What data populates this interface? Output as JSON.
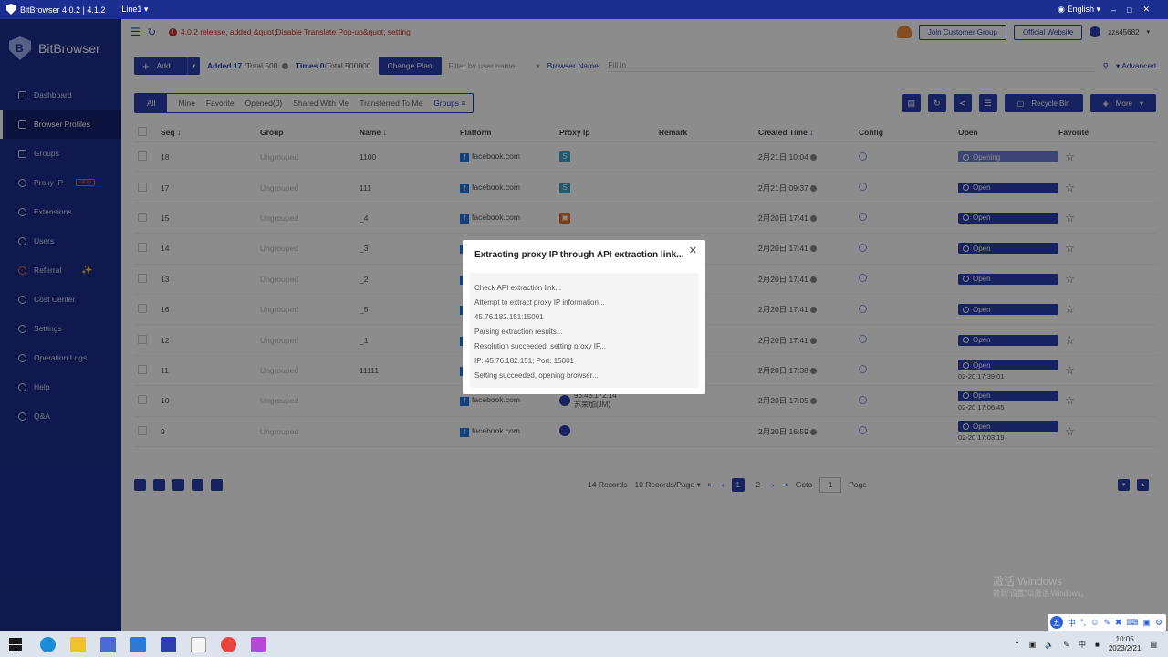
{
  "window": {
    "title": "BitBrowser 4.0.2 | 4.1.2",
    "line": "Line1",
    "language": "English"
  },
  "sidebar": {
    "brand": "BitBrowser",
    "items": [
      {
        "label": "Dashboard",
        "icon": "dashboard-icon"
      },
      {
        "label": "Browser Profiles",
        "icon": "grid-icon",
        "active": true
      },
      {
        "label": "Groups",
        "icon": "layers-icon"
      },
      {
        "label": "Proxy IP",
        "icon": "location-icon",
        "badge": "NEW"
      },
      {
        "label": "Extensions",
        "icon": "puzzle-icon"
      },
      {
        "label": "Users",
        "icon": "users-icon"
      },
      {
        "label": "Referral",
        "icon": "referral-icon",
        "badge": "✨"
      },
      {
        "label": "Cost Center",
        "icon": "shield-icon"
      },
      {
        "label": "Settings",
        "icon": "gear-icon"
      },
      {
        "label": "Operation Logs",
        "icon": "logs-icon"
      },
      {
        "label": "Help",
        "icon": "help-icon"
      },
      {
        "label": "Q&A",
        "icon": "info-icon"
      }
    ]
  },
  "topbar": {
    "notice": "4.0.2 release, added &quot;Disable Translate Pop-up&quot; setting",
    "join_group": "Join Customer Group",
    "official_site": "Official Website",
    "username": "zzs45682"
  },
  "toolbar": {
    "add_label": "Add",
    "added_label": "Added",
    "added_value": "17",
    "added_total": "/Total 500",
    "times_label": "Times",
    "times_value": "0",
    "times_total": "/Total 500000",
    "change_plan": "Change Plan",
    "filter_placeholder": "Filter by user name",
    "browser_name_label": "Browser Name:",
    "browser_name_placeholder": "Fill in",
    "advanced": "Advanced"
  },
  "tabs": {
    "all": "All",
    "mine": "Mine",
    "favorite": "Favorite",
    "opened": "Opened(0)",
    "shared": "Shared With Me",
    "transferred": "Transferred To Me",
    "groups": "Groups",
    "recycle_bin": "Recycle Bin",
    "more": "More"
  },
  "table": {
    "headers": {
      "seq": "Seq",
      "group": "Group",
      "name": "Name",
      "platform": "Platform",
      "proxy_ip": "Proxy Ip",
      "remark": "Remark",
      "created": "Created Time",
      "config": "Config",
      "open": "Open",
      "favorite": "Favorite"
    },
    "rows": [
      {
        "seq": "18",
        "group": "Ungrouped",
        "name": "1100",
        "platform": "facebook.com",
        "proxy": "S",
        "created": "2月21日 10:04",
        "open": "Opening",
        "open_time": ""
      },
      {
        "seq": "17",
        "group": "Ungrouped",
        "name": "111",
        "platform": "facebook.com",
        "proxy": "S",
        "created": "2月21日 09:37",
        "open": "Open",
        "open_time": ""
      },
      {
        "seq": "15",
        "group": "Ungrouped",
        "name": "_4",
        "platform": "facebook.com",
        "proxy": "orange",
        "created": "2月20日 17:41",
        "open": "Open",
        "open_time": ""
      },
      {
        "seq": "14",
        "group": "Ungrouped",
        "name": "_3",
        "platform": "facebook.com",
        "proxy": "",
        "created": "2月20日 17:41",
        "open": "Open",
        "open_time": ""
      },
      {
        "seq": "13",
        "group": "Ungrouped",
        "name": "_2",
        "platform": "facebook.com",
        "proxy": "",
        "created": "2月20日 17:41",
        "open": "Open",
        "open_time": ""
      },
      {
        "seq": "16",
        "group": "Ungrouped",
        "name": "_5",
        "platform": "facebook.com",
        "proxy": "",
        "created": "2月20日 17:41",
        "open": "Open",
        "open_time": ""
      },
      {
        "seq": "12",
        "group": "Ungrouped",
        "name": "_1",
        "platform": "facebook.com",
        "proxy": "",
        "created": "2月20日 17:41",
        "open": "Open",
        "open_time": ""
      },
      {
        "seq": "11",
        "group": "Ungrouped",
        "name": "11111",
        "platform": "facebook.com",
        "proxy": "",
        "created": "2月20日 17:38",
        "open": "Open",
        "open_time": "02-20 17:39:01"
      },
      {
        "seq": "10",
        "group": "Ungrouped",
        "name": "",
        "platform": "facebook.com",
        "proxy": "hex",
        "proxy_ip": "96.43.172.14",
        "proxy_loc": "苏荣加(JM)",
        "created": "2月20日 17:05",
        "open": "Open",
        "open_time": "02-20 17:06:45"
      },
      {
        "seq": "9",
        "group": "Ungrouped",
        "name": "",
        "platform": "facebook.com",
        "proxy": "hex",
        "created": "2月20日 16:59",
        "open": "Open",
        "open_time": "02-20 17:03:19"
      }
    ]
  },
  "pagination": {
    "records": "14 Records",
    "per_page": "10 Records/Page",
    "page1": "1",
    "page2": "2",
    "goto_label": "Goto",
    "goto_value": "1",
    "page_label": "Page"
  },
  "modal": {
    "title": "Extracting proxy IP through API extraction link...",
    "lines": [
      "Check API extraction link...",
      "Attempt to extract proxy IP information...",
      "45.76.182.151:15001",
      "Parsing extraction results...",
      "Resolution succeeded, setting proxy IP...",
      "IP: 45.76.182.151; Port: 15001",
      "Setting succeeded, opening browser..."
    ]
  },
  "watermark": {
    "line1": "激活 Windows",
    "line2": "转到\"设置\"以激活 Windows。"
  },
  "taskbar": {
    "time": "10:05",
    "date": "2023/2/21",
    "ime": "中"
  },
  "colors": {
    "primary": "#2b3fb0",
    "sidebar": "#1c2e8f",
    "notice": "#d32f2f"
  }
}
